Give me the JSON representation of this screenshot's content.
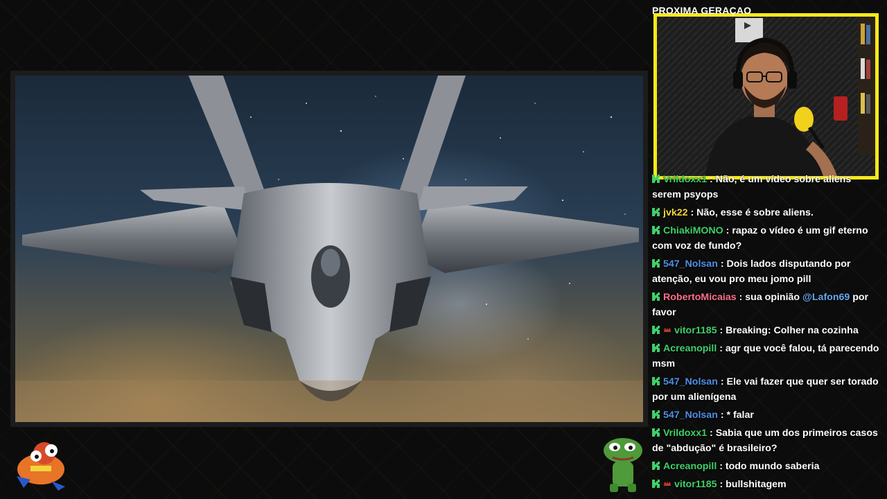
{
  "chat_header": "PROXIMA GERAÇAO",
  "colors": {
    "webcam_border": "#f7e91b",
    "badge_green": "#3fd06a",
    "mention": "#66a8f0"
  },
  "chat": {
    "messages": [
      {
        "user": "Vrildoxx1",
        "color": "#3fd06a",
        "sub": false,
        "text": "Não, é um vídeo sobre aliens serem psyops",
        "mention": ""
      },
      {
        "user": "jvk22",
        "color": "#f2d53c",
        "sub": false,
        "text": "Não, esse é sobre aliens.",
        "mention": ""
      },
      {
        "user": "ChiakiMONO",
        "color": "#3fd06a",
        "sub": false,
        "text": "rapaz o vídeo é um gif eterno com voz de fundo?",
        "mention": ""
      },
      {
        "user": "547_Nolsan",
        "color": "#4f8fe6",
        "sub": false,
        "text": "Dois lados disputando por atenção, eu vou pro meu jomo pill",
        "mention": ""
      },
      {
        "user": "RobertoMicaias",
        "color": "#ff6f8a",
        "sub": false,
        "text": "sua opinião ",
        "mention": "@Lafon69",
        "text_after": " por favor"
      },
      {
        "user": "vitor1185",
        "color": "#3fd06a",
        "sub": true,
        "text": "Breaking: Colher na cozinha",
        "mention": ""
      },
      {
        "user": "Acreanopill",
        "color": "#3fd06a",
        "sub": false,
        "text": "agr que você falou, tá parecendo msm",
        "mention": ""
      },
      {
        "user": "547_Nolsan",
        "color": "#4f8fe6",
        "sub": false,
        "text": "Ele vai fazer que quer ser torado por um alienígena",
        "mention": ""
      },
      {
        "user": "547_Nolsan",
        "color": "#4f8fe6",
        "sub": false,
        "text": "* falar",
        "mention": ""
      },
      {
        "user": "Vrildoxx1",
        "color": "#3fd06a",
        "sub": false,
        "text": "Sabia que um dos primeiros casos de \"abdução\" é brasileiro?",
        "mention": ""
      },
      {
        "user": "Acreanopill",
        "color": "#3fd06a",
        "sub": false,
        "text": "todo mundo saberia",
        "mention": ""
      },
      {
        "user": "vitor1185",
        "color": "#3fd06a",
        "sub": true,
        "text": "bullshitagem",
        "mention": ""
      }
    ]
  },
  "icons": {
    "chat_badge": "kick-badge-icon",
    "sub_badge": "sub-crown-icon"
  }
}
